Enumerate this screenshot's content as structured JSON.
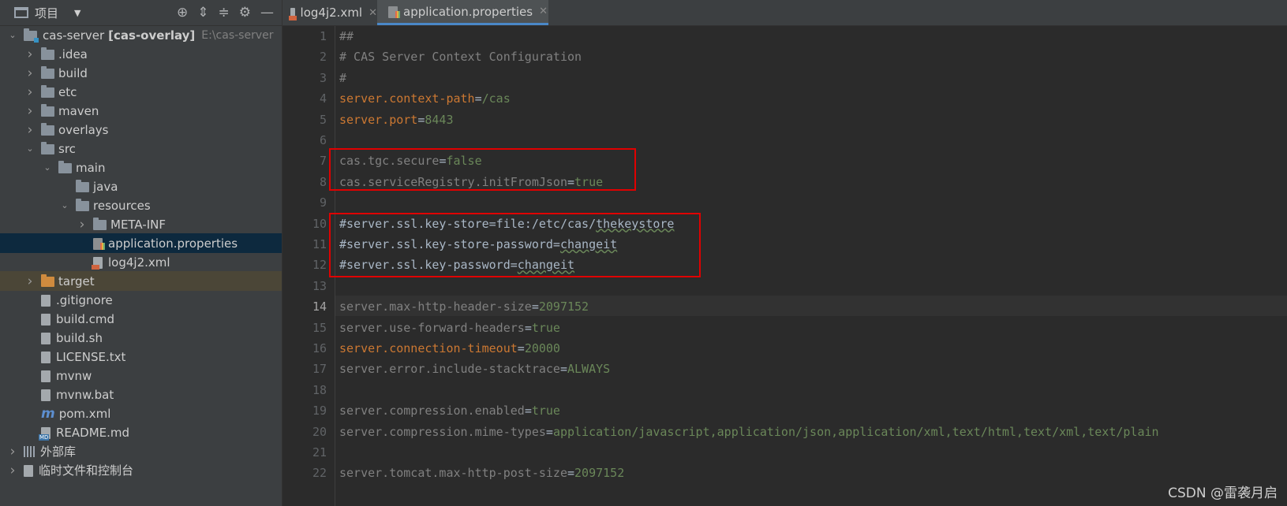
{
  "project_panel": {
    "title": "项目",
    "tree": [
      {
        "label": "cas-server",
        "suffix": "[cas-overlay]",
        "path": "E:\\cas-server",
        "depth": 0,
        "expanded": true,
        "kind": "module"
      },
      {
        "label": ".idea",
        "depth": 1,
        "expanded": false,
        "kind": "folder"
      },
      {
        "label": "build",
        "depth": 1,
        "expanded": false,
        "kind": "folder"
      },
      {
        "label": "etc",
        "depth": 1,
        "expanded": false,
        "kind": "folder"
      },
      {
        "label": "maven",
        "depth": 1,
        "expanded": false,
        "kind": "folder"
      },
      {
        "label": "overlays",
        "depth": 1,
        "expanded": false,
        "kind": "folder"
      },
      {
        "label": "src",
        "depth": 1,
        "expanded": true,
        "kind": "folder"
      },
      {
        "label": "main",
        "depth": 2,
        "expanded": true,
        "kind": "folder"
      },
      {
        "label": "java",
        "depth": 3,
        "kind": "folder"
      },
      {
        "label": "resources",
        "depth": 3,
        "expanded": true,
        "kind": "folder"
      },
      {
        "label": "META-INF",
        "depth": 4,
        "expanded": false,
        "kind": "folder"
      },
      {
        "label": "application.properties",
        "depth": 4,
        "kind": "props",
        "selected": true
      },
      {
        "label": "log4j2.xml",
        "depth": 4,
        "kind": "xml"
      },
      {
        "label": "target",
        "depth": 1,
        "expanded": false,
        "kind": "folder-orange",
        "highlight": true
      },
      {
        "label": ".gitignore",
        "depth": 1,
        "kind": "file"
      },
      {
        "label": "build.cmd",
        "depth": 1,
        "kind": "file"
      },
      {
        "label": "build.sh",
        "depth": 1,
        "kind": "file"
      },
      {
        "label": "LICENSE.txt",
        "depth": 1,
        "kind": "file"
      },
      {
        "label": "mvnw",
        "depth": 1,
        "kind": "file"
      },
      {
        "label": "mvnw.bat",
        "depth": 1,
        "kind": "file"
      },
      {
        "label": "pom.xml",
        "depth": 1,
        "kind": "maven"
      },
      {
        "label": "README.md",
        "depth": 1,
        "kind": "md"
      },
      {
        "label": "外部库",
        "depth": 0,
        "expanded": false,
        "kind": "libs"
      },
      {
        "label": "临时文件和控制台",
        "depth": 0,
        "expanded": false,
        "kind": "scratch"
      }
    ]
  },
  "tabs": [
    {
      "label": "log4j2.xml",
      "active": false
    },
    {
      "label": "application.properties",
      "active": true
    }
  ],
  "editor": {
    "current_line": 14,
    "lines": [
      {
        "num": "1",
        "parts": [
          {
            "t": "##",
            "c": "c"
          }
        ]
      },
      {
        "num": "2",
        "parts": [
          {
            "t": "# CAS Server Context Configuration",
            "c": "c"
          }
        ]
      },
      {
        "num": "3",
        "parts": [
          {
            "t": "#",
            "c": "c"
          }
        ]
      },
      {
        "num": "4",
        "parts": [
          {
            "t": "server.context-path",
            "c": "k"
          },
          {
            "t": "=",
            "c": "p"
          },
          {
            "t": "/cas",
            "c": "v"
          }
        ]
      },
      {
        "num": "5",
        "parts": [
          {
            "t": "server.port",
            "c": "k"
          },
          {
            "t": "=",
            "c": "p"
          },
          {
            "t": "8443",
            "c": "v"
          }
        ]
      },
      {
        "num": "6",
        "parts": []
      },
      {
        "num": "7",
        "parts": [
          {
            "t": "cas.tgc.secure",
            "c": "c"
          },
          {
            "t": "=",
            "c": "p"
          },
          {
            "t": "false",
            "c": "v"
          }
        ]
      },
      {
        "num": "8",
        "parts": [
          {
            "t": "cas.serviceRegistry.initFromJson",
            "c": "c"
          },
          {
            "t": "=",
            "c": "p"
          },
          {
            "t": "true",
            "c": "v"
          }
        ]
      },
      {
        "num": "9",
        "parts": []
      },
      {
        "num": "10",
        "parts": [
          {
            "t": "#server.ssl.key-store=file:/etc/cas/",
            "c": "p"
          },
          {
            "t": "thekeystore",
            "c": "p",
            "typo": true
          }
        ]
      },
      {
        "num": "11",
        "parts": [
          {
            "t": "#server.ssl.key-store-password=",
            "c": "p"
          },
          {
            "t": "changeit",
            "c": "p",
            "typo": true
          }
        ]
      },
      {
        "num": "12",
        "parts": [
          {
            "t": "#server.ssl.key-password=",
            "c": "p"
          },
          {
            "t": "changeit",
            "c": "p",
            "typo": true
          }
        ]
      },
      {
        "num": "13",
        "parts": []
      },
      {
        "num": "14",
        "parts": [
          {
            "t": "server.max-http-header-size",
            "c": "c"
          },
          {
            "t": "=",
            "c": "p"
          },
          {
            "t": "2097152",
            "c": "v"
          }
        ]
      },
      {
        "num": "15",
        "parts": [
          {
            "t": "server.use-forward-headers",
            "c": "c"
          },
          {
            "t": "=",
            "c": "p"
          },
          {
            "t": "true",
            "c": "v"
          }
        ]
      },
      {
        "num": "16",
        "parts": [
          {
            "t": "server.connection-timeout",
            "c": "k"
          },
          {
            "t": "=",
            "c": "p"
          },
          {
            "t": "20000",
            "c": "v"
          }
        ]
      },
      {
        "num": "17",
        "parts": [
          {
            "t": "server.error.include-stacktrace",
            "c": "c"
          },
          {
            "t": "=",
            "c": "p"
          },
          {
            "t": "ALWAYS",
            "c": "v"
          }
        ]
      },
      {
        "num": "18",
        "parts": []
      },
      {
        "num": "19",
        "parts": [
          {
            "t": "server.compression.enabled",
            "c": "c"
          },
          {
            "t": "=",
            "c": "p"
          },
          {
            "t": "true",
            "c": "v"
          }
        ]
      },
      {
        "num": "20",
        "parts": [
          {
            "t": "server.compression.mime-types",
            "c": "c"
          },
          {
            "t": "=",
            "c": "p"
          },
          {
            "t": "application/javascript,application/json,application/xml,text/html,text/xml,text/plain",
            "c": "v"
          }
        ]
      },
      {
        "num": "21",
        "parts": []
      },
      {
        "num": "22",
        "parts": [
          {
            "t": "server.tomcat.max-http-post-size",
            "c": "c"
          },
          {
            "t": "=",
            "c": "p"
          },
          {
            "t": "2097152",
            "c": "v"
          }
        ]
      }
    ]
  },
  "watermark": "CSDN @雷袭月启"
}
